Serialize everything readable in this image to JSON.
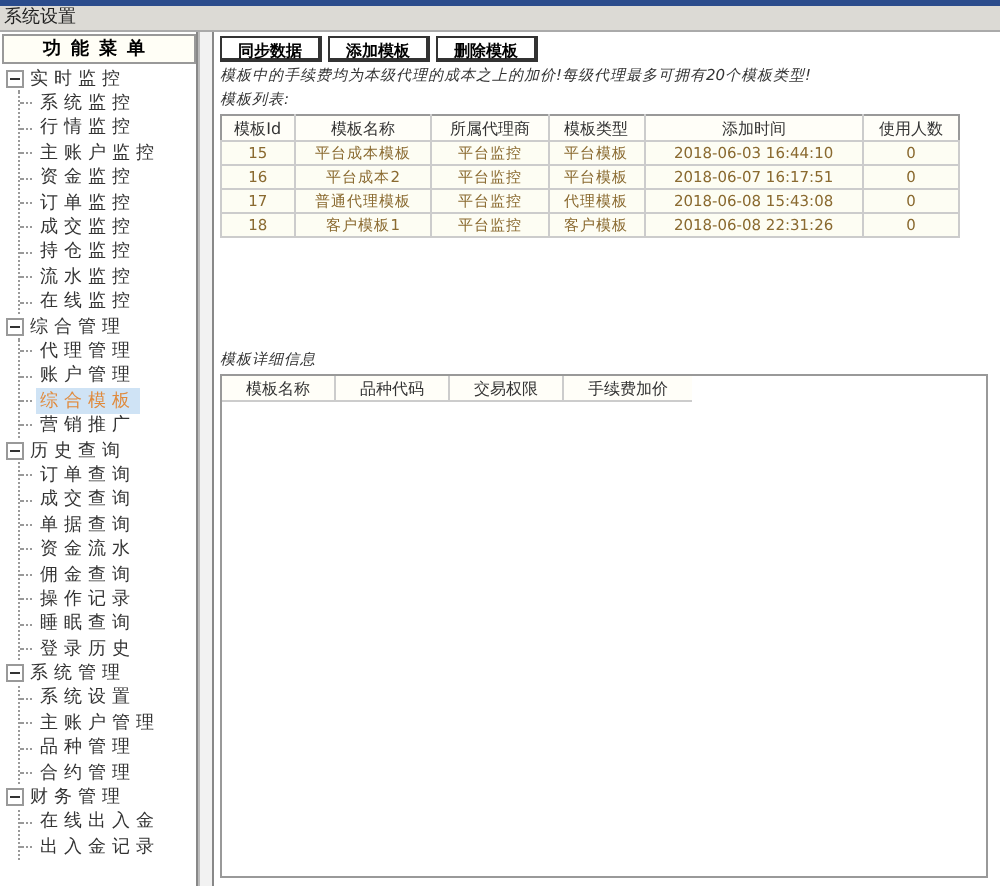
{
  "window": {
    "title": "系统设置"
  },
  "sidebar": {
    "header": "功能菜单",
    "groups": [
      {
        "label": "实时监控",
        "expanded": true,
        "children": [
          {
            "label": "系统监控",
            "selected": false
          },
          {
            "label": "行情监控",
            "selected": false
          },
          {
            "label": "主账户监控",
            "selected": false
          },
          {
            "label": "资金监控",
            "selected": false
          },
          {
            "label": "订单监控",
            "selected": false
          },
          {
            "label": "成交监控",
            "selected": false
          },
          {
            "label": "持仓监控",
            "selected": false
          },
          {
            "label": "流水监控",
            "selected": false
          },
          {
            "label": "在线监控",
            "selected": false
          }
        ]
      },
      {
        "label": "综合管理",
        "expanded": true,
        "children": [
          {
            "label": "代理管理",
            "selected": false
          },
          {
            "label": "账户管理",
            "selected": false
          },
          {
            "label": "综合模板",
            "selected": true
          },
          {
            "label": "营销推广",
            "selected": false
          }
        ]
      },
      {
        "label": "历史查询",
        "expanded": true,
        "children": [
          {
            "label": "订单查询",
            "selected": false
          },
          {
            "label": "成交查询",
            "selected": false
          },
          {
            "label": "单据查询",
            "selected": false
          },
          {
            "label": "资金流水",
            "selected": false
          },
          {
            "label": "佣金查询",
            "selected": false
          },
          {
            "label": "操作记录",
            "selected": false
          },
          {
            "label": "睡眠查询",
            "selected": false
          },
          {
            "label": "登录历史",
            "selected": false
          }
        ]
      },
      {
        "label": "系统管理",
        "expanded": true,
        "children": [
          {
            "label": "系统设置",
            "selected": false
          },
          {
            "label": "主账户管理",
            "selected": false
          },
          {
            "label": "品种管理",
            "selected": false
          },
          {
            "label": "合约管理",
            "selected": false
          }
        ]
      },
      {
        "label": "财务管理",
        "expanded": true,
        "children": [
          {
            "label": "在线出入金",
            "selected": false
          },
          {
            "label": "出入金记录",
            "selected": false
          }
        ]
      }
    ]
  },
  "toolbar": {
    "buttons": [
      "同步数据",
      "添加模板",
      "删除模板"
    ]
  },
  "note": "模板中的手续费均为本级代理的成本之上的加价!每级代理最多可拥有20个模板类型!",
  "template_list": {
    "label": "模板列表:",
    "columns": [
      "模板Id",
      "模板名称",
      "所属代理商",
      "模板类型",
      "添加时间",
      "使用人数"
    ],
    "rows": [
      [
        "15",
        "平台成本模板",
        "平台监控",
        "平台模板",
        "2018-06-03 16:44:10",
        "0"
      ],
      [
        "16",
        "平台成本2",
        "平台监控",
        "平台模板",
        "2018-06-07 16:17:51",
        "0"
      ],
      [
        "17",
        "普通代理模板",
        "平台监控",
        "代理模板",
        "2018-06-08 15:43:08",
        "0"
      ],
      [
        "18",
        "客户模板1",
        "平台监控",
        "客户模板",
        "2018-06-08 22:31:26",
        "0"
      ]
    ]
  },
  "template_detail": {
    "label": "模板详细信息",
    "columns": [
      "模板名称",
      "品种代码",
      "交易权限",
      "手续费加价"
    ]
  }
}
